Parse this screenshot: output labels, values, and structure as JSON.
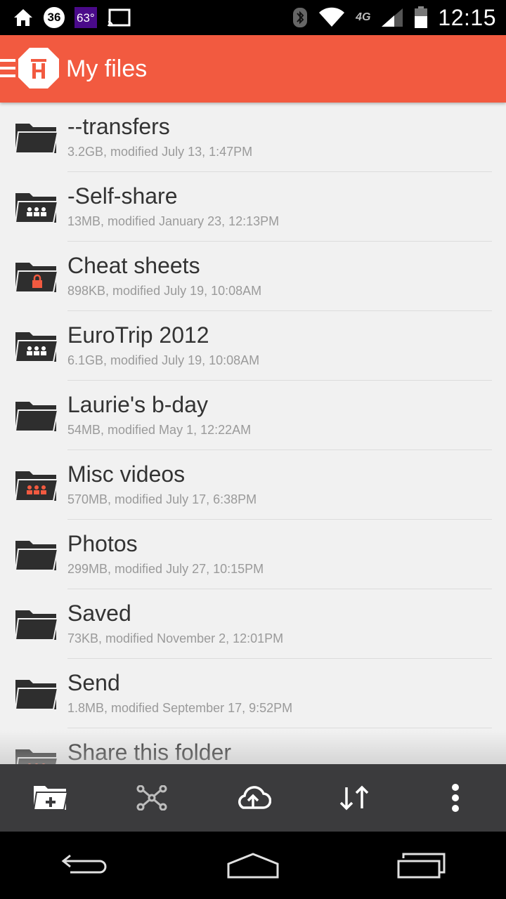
{
  "status_bar": {
    "notification_count": "36",
    "temperature": "63°",
    "network": "4G",
    "time": "12:15"
  },
  "app_bar": {
    "title": "My files"
  },
  "files": [
    {
      "name": "--transfers",
      "meta": "3.2GB, modified July 13, 1:47PM",
      "folder_type": "plain"
    },
    {
      "name": "-Self-share",
      "meta": "13MB, modified January 23, 12:13PM",
      "folder_type": "shared"
    },
    {
      "name": "Cheat sheets",
      "meta": "898KB, modified July 19, 10:08AM",
      "folder_type": "locked"
    },
    {
      "name": "EuroTrip 2012",
      "meta": "6.1GB, modified July 19, 10:08AM",
      "folder_type": "shared"
    },
    {
      "name": "Laurie's b-day",
      "meta": "54MB, modified May 1, 12:22AM",
      "folder_type": "plain"
    },
    {
      "name": "Misc videos",
      "meta": "570MB, modified July 17, 6:38PM",
      "folder_type": "shared-orange"
    },
    {
      "name": "Photos",
      "meta": "299MB, modified July 27, 10:15PM",
      "folder_type": "plain"
    },
    {
      "name": "Saved",
      "meta": "73KB, modified November 2, 12:01PM",
      "folder_type": "plain"
    },
    {
      "name": "Send",
      "meta": "1.8MB, modified September 17, 9:52PM",
      "folder_type": "plain"
    },
    {
      "name": "Share this folder",
      "meta": "",
      "folder_type": "shared-orange"
    }
  ],
  "toolbar": {
    "items": [
      "new-folder-icon",
      "network-icon",
      "cloud-upload-icon",
      "sort-icon",
      "more-options-icon"
    ]
  },
  "nav": {
    "items": [
      "back-icon",
      "home-icon",
      "recent-apps-icon"
    ]
  },
  "colors": {
    "accent": "#f25a40",
    "folder": "#2e2e2e",
    "toolbar": "#3b3b3d"
  }
}
